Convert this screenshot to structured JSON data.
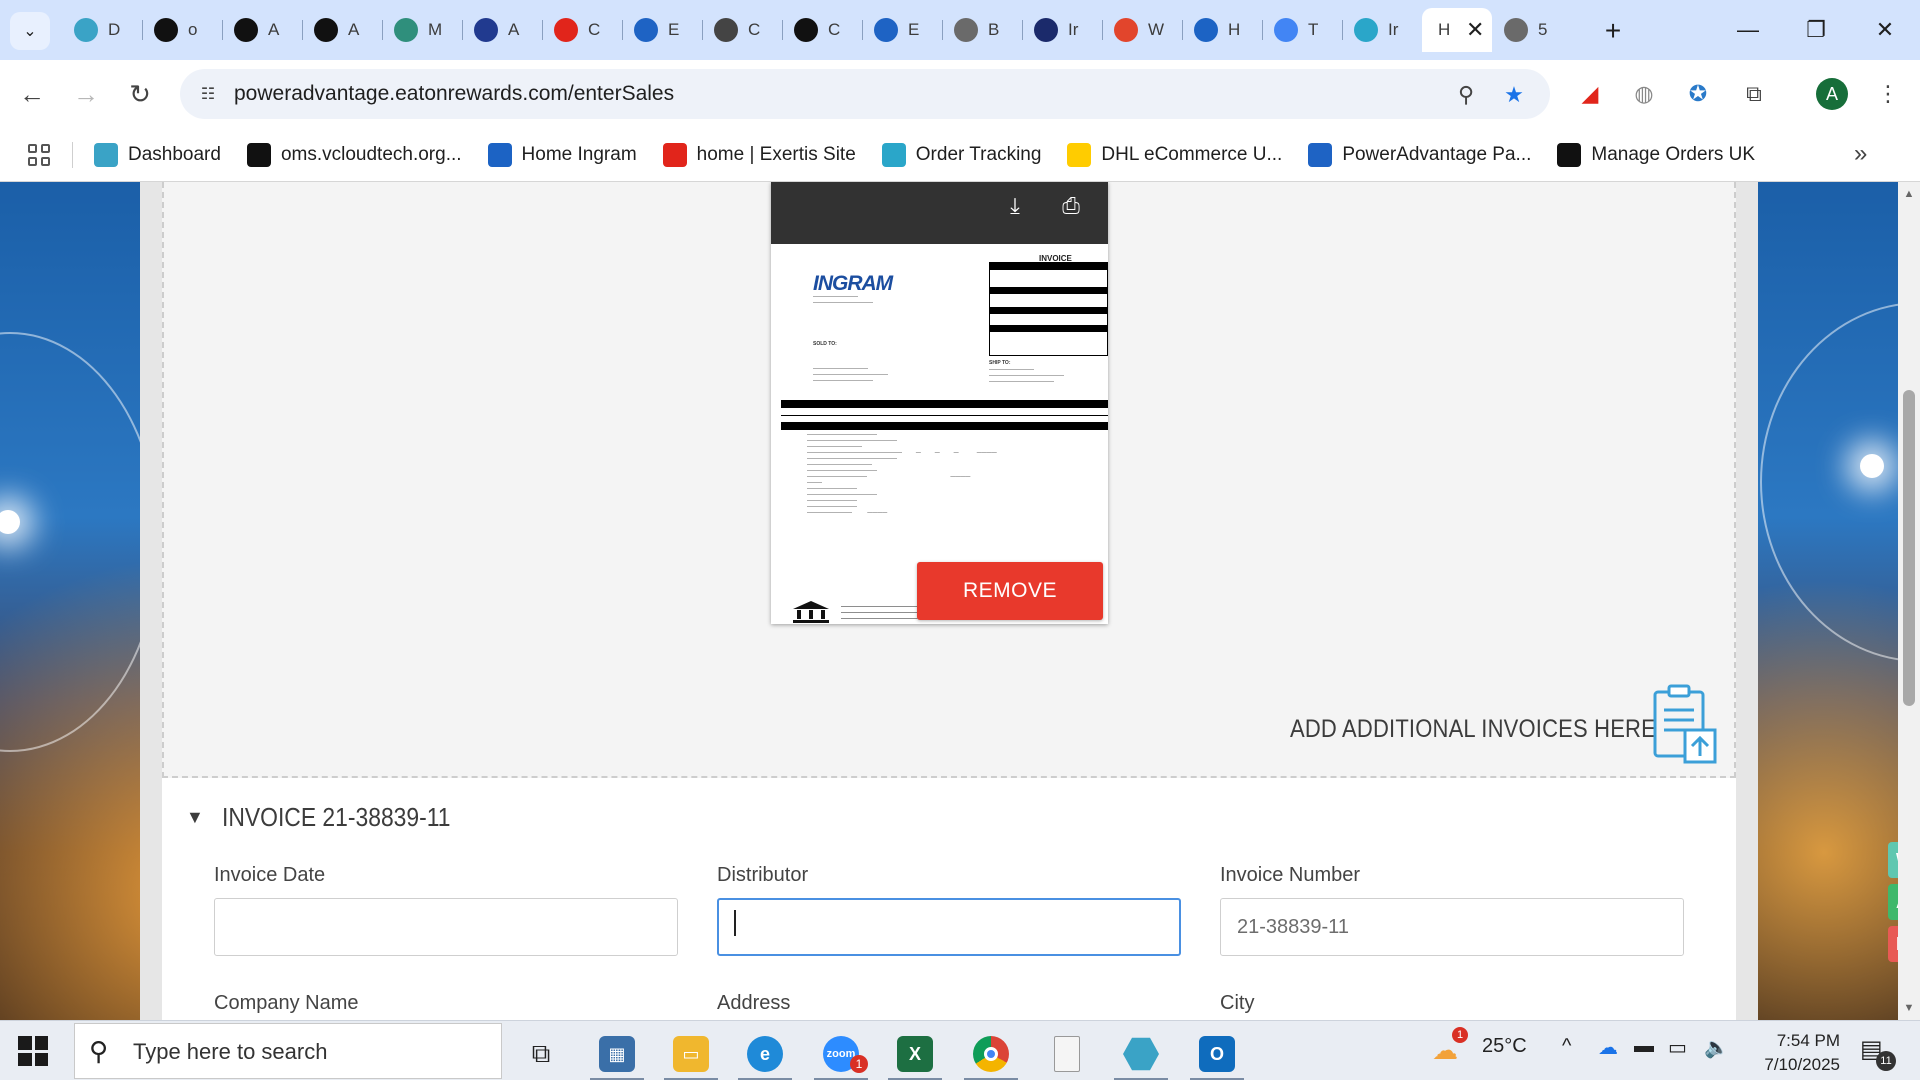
{
  "browser": {
    "tabs": [
      {
        "icon": "hexagon-icon",
        "title": "D",
        "color": "#3aa3c6"
      },
      {
        "icon": "triangle-logo-icon",
        "title": "o",
        "color": "#111111"
      },
      {
        "icon": "amazon-icon",
        "title": "A",
        "color": "#111111"
      },
      {
        "icon": "amazon-icon",
        "title": "A",
        "color": "#111111"
      },
      {
        "icon": "marketplace-icon",
        "title": "M",
        "color": "#2f8f7c"
      },
      {
        "icon": "arrow-logo-icon",
        "title": "A",
        "color": "#213a8f"
      },
      {
        "icon": "exertis-icon",
        "title": "C",
        "color": "#e1251b"
      },
      {
        "icon": "e-logo-icon",
        "title": "E",
        "color": "#1e63c4"
      },
      {
        "icon": "openai-icon",
        "title": "C",
        "color": "#444444"
      },
      {
        "icon": "openai-icon",
        "title": "C",
        "color": "#111111"
      },
      {
        "icon": "e-logo-icon",
        "title": "E",
        "color": "#1e63c4"
      },
      {
        "icon": "lightbulb-icon",
        "title": "B",
        "color": "#6a6a6a"
      },
      {
        "icon": "bu-logo-icon",
        "title": "Ir",
        "color": "#1b2a6b"
      },
      {
        "icon": "s-logo-icon",
        "title": "W",
        "color": "#e2452c"
      },
      {
        "icon": "ingram-icon",
        "title": "H",
        "color": "#1c63c4"
      },
      {
        "icon": "google-icon",
        "title": "T",
        "color": "#4285f4"
      },
      {
        "icon": "c-logo-icon",
        "title": "Ir",
        "color": "#2aa6c9"
      },
      {
        "icon": "none",
        "title": "H",
        "color": "#ffffff",
        "active": true
      },
      {
        "icon": "globe-icon",
        "title": "5",
        "color": "#6a6a6a"
      }
    ],
    "url": "poweradvantage.eatonrewards.com/enterSales",
    "bookmarks": [
      {
        "icon": "hexagon-icon",
        "label": "Dashboard",
        "color": "#3aa3c6"
      },
      {
        "icon": "triangle-logo-icon",
        "label": "oms.vcloudtech.org...",
        "color": "#111111"
      },
      {
        "icon": "ingram-icon",
        "label": "Home Ingram",
        "color": "#1c63c4"
      },
      {
        "icon": "exertis-icon",
        "label": "home | Exertis Site",
        "color": "#e1251b"
      },
      {
        "icon": "c-logo-icon",
        "label": "Order Tracking",
        "color": "#2aa6c9"
      },
      {
        "icon": "dhl-icon",
        "label": "DHL eCommerce U...",
        "color": "#ffcc00"
      },
      {
        "icon": "e-logo-icon",
        "label": "PowerAdvantage Pa...",
        "color": "#1e63c4"
      },
      {
        "icon": "amazon-icon",
        "label": "Manage Orders UK",
        "color": "#111111"
      }
    ],
    "profile_initial": "A"
  },
  "preview": {
    "remove_label": "REMOVE",
    "doc": {
      "logo": "INGRAM",
      "title": "INVOICE",
      "sold_to": "SOLD TO:",
      "ship_to": "SHIP TO:"
    }
  },
  "upload": {
    "add_more_label": "ADD ADDITIONAL INVOICES HERE"
  },
  "invoice": {
    "section_title": "INVOICE 21-38839-11",
    "fields": {
      "invoice_date": {
        "label": "Invoice Date",
        "value": ""
      },
      "distributor": {
        "label": "Distributor",
        "value": ""
      },
      "invoice_number": {
        "label": "Invoice Number",
        "value": "21-38839-11"
      },
      "company_name": {
        "label": "Company Name"
      },
      "address": {
        "label": "Address"
      },
      "city": {
        "label": "City"
      }
    }
  },
  "taskbar": {
    "search_placeholder": "Type here to search",
    "weather": "25°C",
    "weather_badge": "1",
    "time": "7:54 PM",
    "date": "7/10/2025",
    "notification_count": "11",
    "zoom_badge": "1"
  },
  "colors": {
    "accent": "#4a90e2",
    "remove": "#e8392c",
    "chrome_tabstrip": "#d3e3fd"
  }
}
